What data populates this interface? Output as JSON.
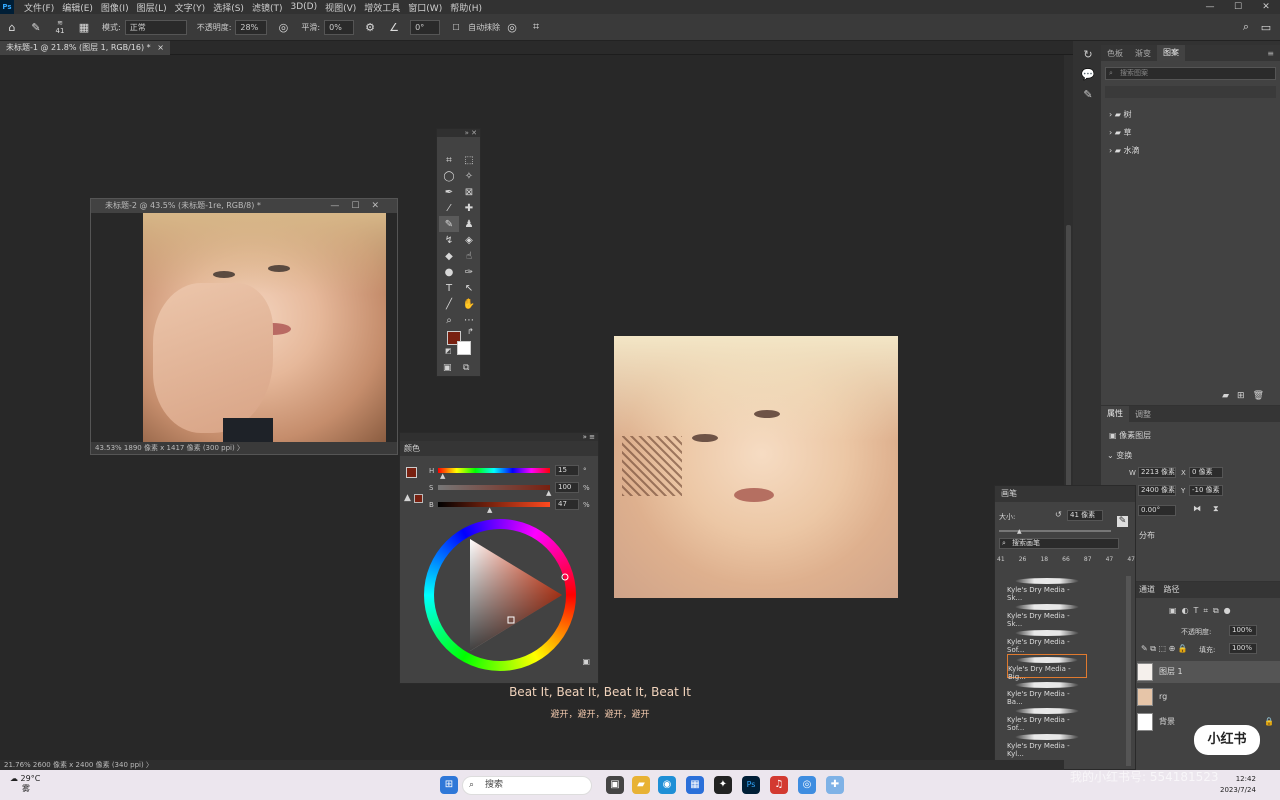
{
  "menubar": {
    "logo": "Ps",
    "items": [
      "文件(F)",
      "编辑(E)",
      "图像(I)",
      "图层(L)",
      "文字(Y)",
      "选择(S)",
      "滤镜(T)",
      "3D(D)",
      "视图(V)",
      "增效工具",
      "窗口(W)",
      "帮助(H)"
    ],
    "min": "—",
    "max": "☐",
    "close": "✕"
  },
  "options": {
    "brush_size": "41",
    "mode_label": "模式:",
    "mode_value": "正常",
    "opacity_label": "不透明度:",
    "opacity_value": "28%",
    "smooth_label": "平滑:",
    "smooth_value": "0%",
    "angle_value": "0°",
    "auto_erase": "自动抹除"
  },
  "tabs": {
    "active": "未标题-1 @ 21.8% (图层 1, RGB/16) *",
    "close": "×"
  },
  "docwin2": {
    "title": "未标题-2 @ 43.5% (未标题-1re, RGB/8) *",
    "status": "43.53%   1890 像素 x 1417 像素 (300 ppi)   〉"
  },
  "statusbar": {
    "text": "21.76%   2600 像素 x 2400 像素 (340 ppi)   〉"
  },
  "color_panel": {
    "tab": "颜色",
    "h_label": "H",
    "h_value": "15",
    "h_unit": "°",
    "s_label": "S",
    "s_value": "100",
    "s_unit": "%",
    "b_label": "B",
    "b_value": "47",
    "b_unit": "%",
    "h_level": 0.04,
    "s_level": 1.0,
    "b_level": 0.47,
    "fg_color": "#782010",
    "bg_color": "#ffffff"
  },
  "patterns_panel": {
    "tabs": [
      "色板",
      "渐变",
      "图案"
    ],
    "search_placeholder": "搜索图案",
    "groups": [
      "树",
      "草",
      "水滴"
    ]
  },
  "properties_panel": {
    "tabs": [
      "属性",
      "调整"
    ],
    "layer_type": "像素图层",
    "transform_label": "变换",
    "w_label": "W",
    "w_value": "2213 像素",
    "x_label": "X",
    "x_value": "0 像素",
    "h_label": "H",
    "h_value": "2400 像素",
    "y_label": "Y",
    "y_value": "-10 像素",
    "angle_value": "0.00°",
    "distribute_label": "分布"
  },
  "layers_panel": {
    "tabs": [
      "通道",
      "路径"
    ],
    "opacity_label": "不透明度:",
    "opacity_value": "100%",
    "fill_label": "填充:",
    "fill_value": "100%",
    "layers": [
      "图层 1",
      "rg",
      "背景"
    ]
  },
  "brush_panel": {
    "tab": "画笔",
    "size_label": "大小:",
    "size_value": "41 像素",
    "search_placeholder": "搜索画笔",
    "preset_sizes": [
      "41",
      "26",
      "18",
      "66",
      "87",
      "47",
      "47"
    ],
    "brushes": [
      "Kyle's Dry Media - Sk...",
      "Kyle's Dry Media - Sk...",
      "Kyle's Dry Media - Sof...",
      "Kyle's Dry Media - Big...",
      "Kyle's Dry Media - Ba...",
      "Kyle's Dry Media - Sof...",
      "Kyle's Dry Media - Kyl..."
    ]
  },
  "subtitles": {
    "line1": "Beat It, Beat It, Beat It, Beat It",
    "line2": "避开，避开，避开，避开"
  },
  "taskbar": {
    "temp": "29°C",
    "weather": "雾",
    "search": "搜索",
    "time": "12:42",
    "date": "2023/7/24"
  },
  "watermark": "我的小红书号: 554181523",
  "badge": "小红书"
}
